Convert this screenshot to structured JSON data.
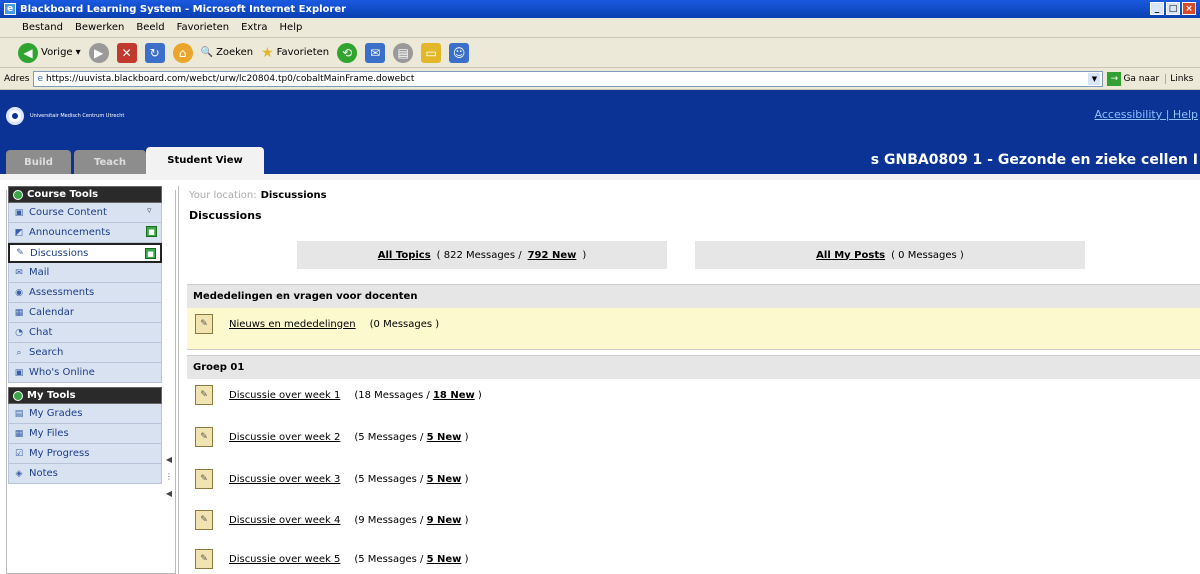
{
  "window": {
    "title": "Blackboard Learning System - Microsoft Internet Explorer"
  },
  "menu": [
    "Bestand",
    "Bewerken",
    "Beeld",
    "Favorieten",
    "Extra",
    "Help"
  ],
  "toolbar": {
    "back": "Vorige",
    "search": "Zoeken",
    "favorites": "Favorieten"
  },
  "address": {
    "label": "Adres",
    "url": "https://uuvista.blackboard.com/webct/urw/lc20804.tp0/cobaltMainFrame.dowebct",
    "go": "Ga naar",
    "links": "Links"
  },
  "header": {
    "institution": "Universitair Medisch Centrum Utrecht",
    "accessibility": "Accessibility | Help"
  },
  "tabs": {
    "build": "Build",
    "teach": "Teach",
    "student": "Student View"
  },
  "course_title": "s GNBA0809 1 - Gezonde en zieke cellen I",
  "sidebar": {
    "course_tools": "Course Tools",
    "course_items": [
      {
        "label": "Course Content",
        "icon": "folder-icon"
      },
      {
        "label": "Announcements",
        "icon": "announcement-icon"
      },
      {
        "label": "Discussions",
        "icon": "discussion-icon"
      },
      {
        "label": "Mail",
        "icon": "mail-icon"
      },
      {
        "label": "Assessments",
        "icon": "assessment-icon"
      },
      {
        "label": "Calendar",
        "icon": "calendar-icon"
      },
      {
        "label": "Chat",
        "icon": "chat-icon"
      },
      {
        "label": "Search",
        "icon": "search-icon"
      },
      {
        "label": "Who's Online",
        "icon": "online-icon"
      }
    ],
    "my_tools": "My Tools",
    "my_items": [
      {
        "label": "My Grades",
        "icon": "grades-icon"
      },
      {
        "label": "My Files",
        "icon": "files-icon"
      },
      {
        "label": "My Progress",
        "icon": "progress-icon"
      },
      {
        "label": "Notes",
        "icon": "notes-icon"
      }
    ]
  },
  "content": {
    "location_label": "Your location:",
    "location": "Discussions",
    "title": "Discussions",
    "all_topics": "All Topics",
    "all_topics_count": "( 822 Messages /",
    "all_topics_new": "792 New",
    "all_topics_end": ")",
    "all_posts": "All My Posts",
    "all_posts_count": "( 0 Messages )",
    "category1": "Mededelingen en vragen voor docenten",
    "news_topic": "Nieuws en mededelingen",
    "news_count": "(0 Messages )",
    "category2": "Groep 01",
    "topics": [
      {
        "label": "Discussie over week 1",
        "count": "(18 Messages /",
        "new": "18 New",
        "end": ")"
      },
      {
        "label": "Discussie over week 2",
        "count": "(5 Messages /",
        "new": "5 New",
        "end": ")"
      },
      {
        "label": "Discussie over week 3",
        "count": "(5 Messages /",
        "new": "5 New",
        "end": ")"
      },
      {
        "label": "Discussie over week 4",
        "count": "(9 Messages /",
        "new": "9 New",
        "end": ")"
      },
      {
        "label": "Discussie over week 5",
        "count": "(5 Messages /",
        "new": "5 New",
        "end": ")"
      }
    ]
  }
}
